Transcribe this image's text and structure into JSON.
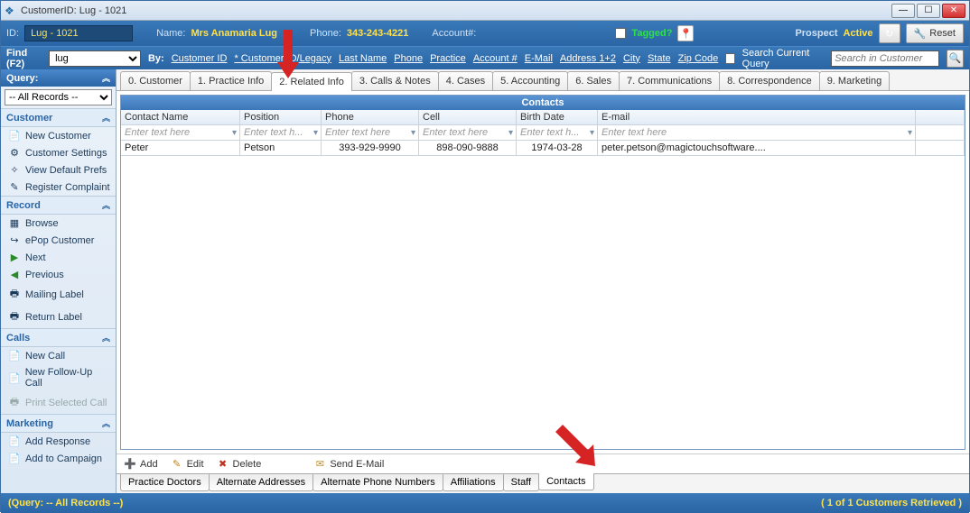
{
  "window": {
    "title": "CustomerID: Lug - 1021"
  },
  "header": {
    "id_label": "ID:",
    "id_value": "Lug - 1021",
    "name_label": "Name:",
    "name_value": "Mrs Anamaria Lug",
    "phone_label": "Phone:",
    "phone_value": "343-243-4221",
    "account_label": "Account#:",
    "tagged_label": "Tagged?",
    "prospect_label": "Prospect",
    "active_label": "Active",
    "reset_label": "Reset"
  },
  "find": {
    "label": "Find (F2)",
    "value": "lug",
    "by_label": "By:",
    "options": [
      "Customer ID",
      "Customer ID/Legacy",
      "Last Name",
      "Phone",
      "Practice",
      "Account #",
      "E-Mail",
      "Address 1+2",
      "City",
      "State",
      "Zip Code"
    ],
    "current_query_label": "Search Current Query",
    "search_placeholder": "Search in Customer"
  },
  "sidebar": {
    "query_label": "Query:",
    "query_value": "-- All Records --",
    "groups": [
      {
        "title": "Customer",
        "items": [
          {
            "label": "New Customer",
            "icon": "📄"
          },
          {
            "label": "Customer Settings",
            "icon": "⚙"
          },
          {
            "label": "View Default Prefs",
            "icon": "✧"
          },
          {
            "label": "Register Complaint",
            "icon": "✎"
          }
        ]
      },
      {
        "title": "Record",
        "items": [
          {
            "label": "Browse",
            "icon": "▦"
          },
          {
            "label": "ePop Customer",
            "icon": "↪"
          },
          {
            "label": "Next",
            "icon": "▶"
          },
          {
            "label": "Previous",
            "icon": "◀"
          },
          {
            "label": "Mailing Label",
            "icon": "🖶"
          },
          {
            "label": "Return Label",
            "icon": "🖶"
          }
        ]
      },
      {
        "title": "Calls",
        "items": [
          {
            "label": "New Call",
            "icon": "📄"
          },
          {
            "label": "New Follow-Up Call",
            "icon": "📄"
          },
          {
            "label": "Print Selected Call",
            "icon": "🖶",
            "disabled": true
          }
        ]
      },
      {
        "title": "Marketing",
        "items": [
          {
            "label": "Add Response",
            "icon": "📄"
          },
          {
            "label": "Add to Campaign",
            "icon": "📄"
          }
        ]
      }
    ]
  },
  "toptabs": [
    "0. Customer",
    "1. Practice Info",
    "2. Related Info",
    "3. Calls & Notes",
    "4. Cases",
    "5. Accounting",
    "6. Sales",
    "7. Communications",
    "8. Correspondence",
    "9. Marketing"
  ],
  "grid": {
    "title": "Contacts",
    "columns": [
      "Contact Name",
      "Position",
      "Phone",
      "Cell",
      "Birth Date",
      "E-mail"
    ],
    "filter_ph": "Enter text here",
    "filter_ph_short": "Enter text h...",
    "rows": [
      {
        "name": "Peter",
        "position": "Petson",
        "phone": "393-929-9990",
        "cell": "898-090-9888",
        "birth": "1974-03-28",
        "email": "peter.petson@magictouchsoftware...."
      }
    ]
  },
  "actions": {
    "add": "Add",
    "edit": "Edit",
    "delete": "Delete",
    "send": "Send E-Mail"
  },
  "bottomtabs": [
    "Practice Doctors",
    "Alternate Addresses",
    "Alternate Phone Numbers",
    "Affiliations",
    "Staff",
    "Contacts"
  ],
  "status": {
    "left": "(Query: -- All Records --)",
    "right": "( 1 of 1 Customers Retrieved )"
  }
}
